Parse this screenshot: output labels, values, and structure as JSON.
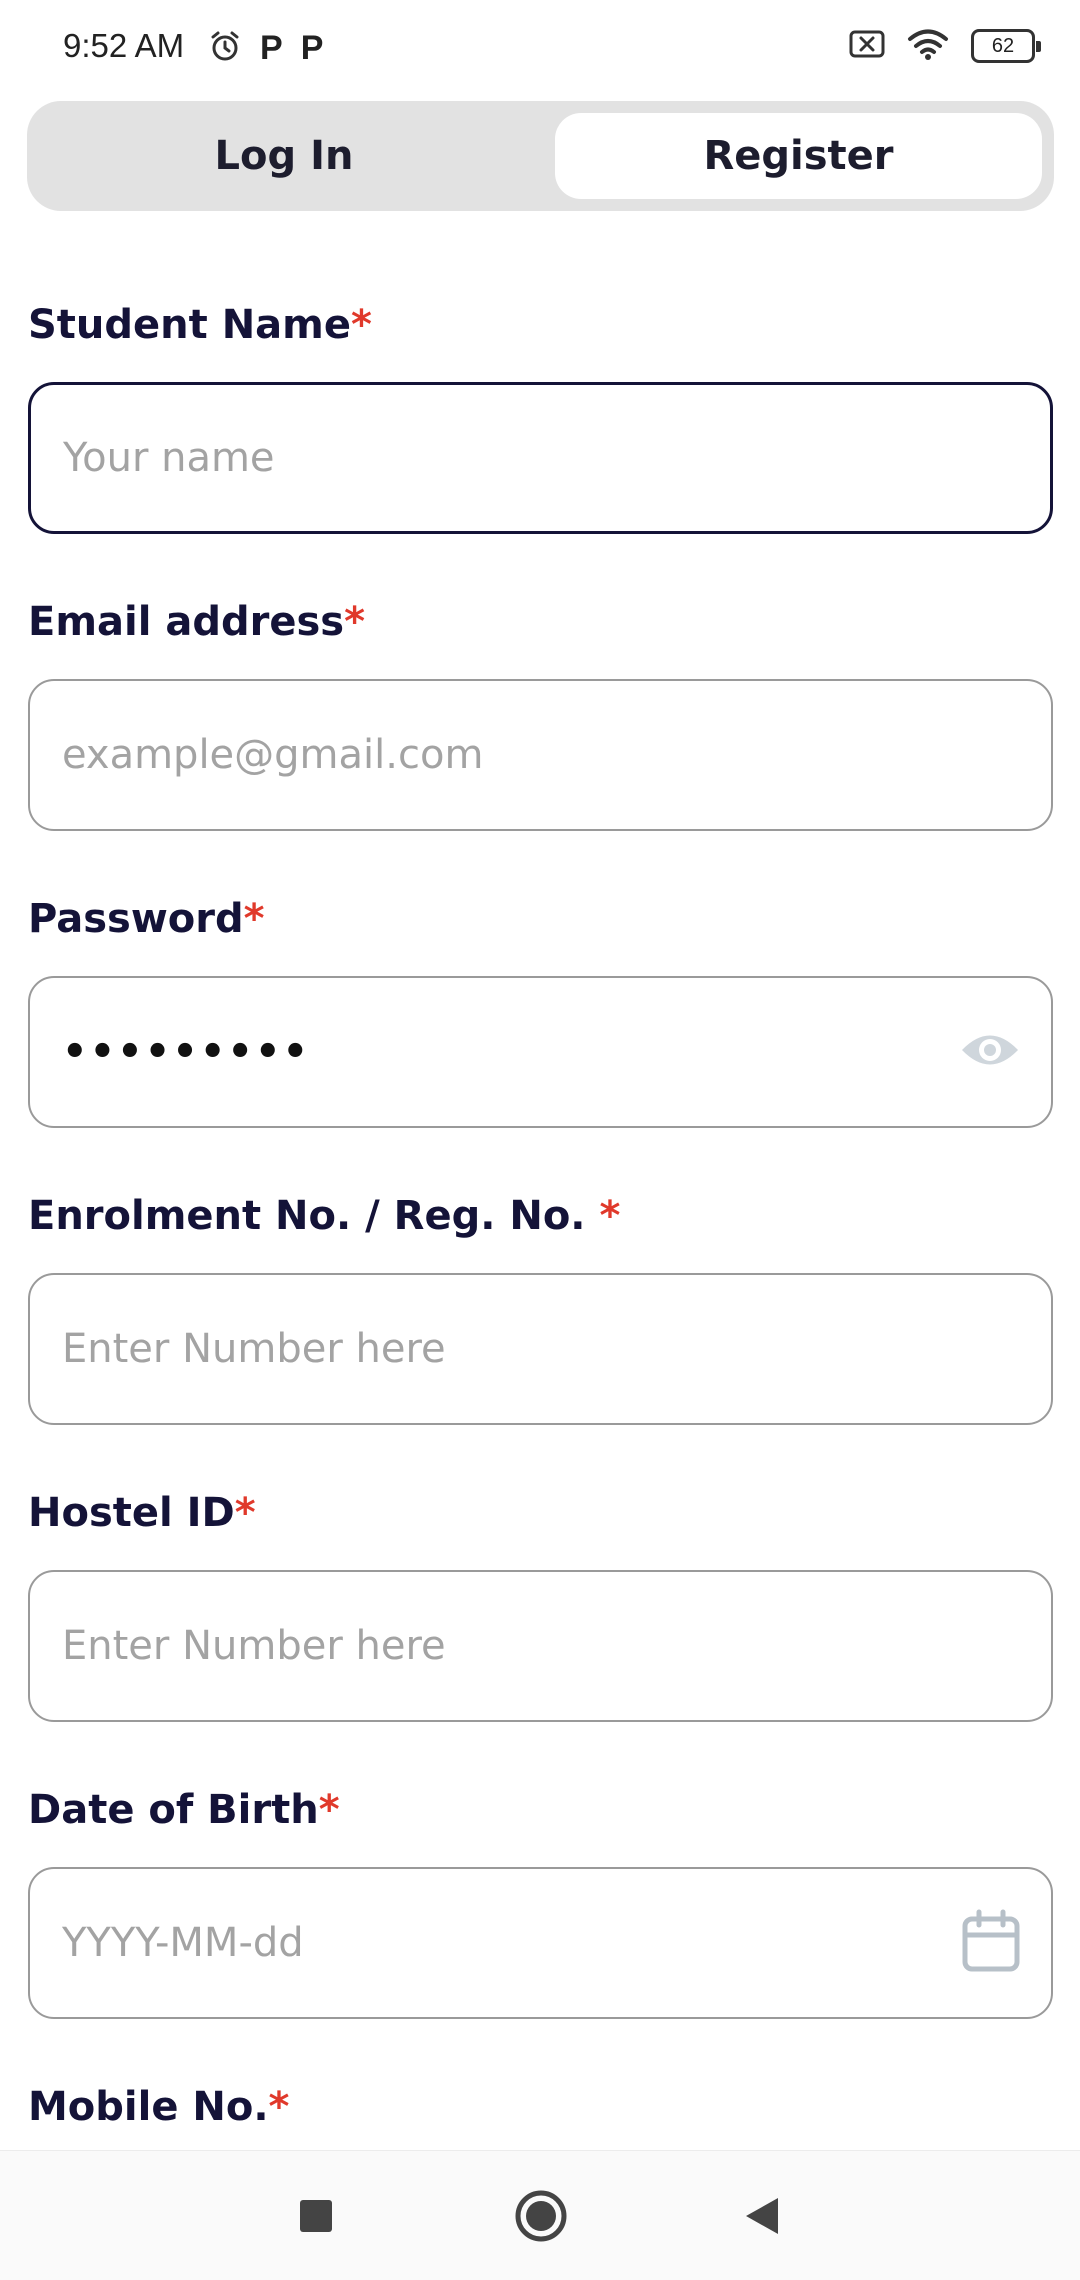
{
  "status_bar": {
    "time": "9:52 AM",
    "icons": [
      "alarm-icon",
      "p-icon",
      "p-icon",
      "sim-x-icon",
      "wifi-icon",
      "battery-icon"
    ],
    "p_glyph": "P",
    "battery": "62"
  },
  "tabs": [
    {
      "label": "Log In",
      "active": false
    },
    {
      "label": "Register",
      "active": true
    }
  ],
  "form": {
    "fields": [
      {
        "label": "Student Name",
        "required_mark": "*",
        "placeholder": "Your name"
      },
      {
        "label": "Email address",
        "required_mark": "*",
        "placeholder": "example@gmail.com"
      },
      {
        "label": "Password",
        "required_mark": "*",
        "value": "•••••••••",
        "trailing_icon": "eye-icon"
      },
      {
        "label": "Enrolment No. / Reg. No. ",
        "required_mark": "*",
        "placeholder": "Enter Number here"
      },
      {
        "label": "Hostel ID",
        "required_mark": "*",
        "placeholder": "Enter Number here"
      },
      {
        "label": "Date of Birth",
        "required_mark": "*",
        "placeholder": "YYYY-MM-dd",
        "trailing_icon": "calendar-icon"
      },
      {
        "label": "Mobile No.",
        "required_mark": "*"
      }
    ]
  },
  "nav_bar": {
    "buttons": [
      "recents-square-icon",
      "home-circle-icon",
      "back-triangle-icon"
    ]
  },
  "colors": {
    "text_dark": "#141338",
    "required": "#e0392b",
    "placeholder": "#a3a3a3",
    "segment_bg": "#e2e2e2"
  }
}
